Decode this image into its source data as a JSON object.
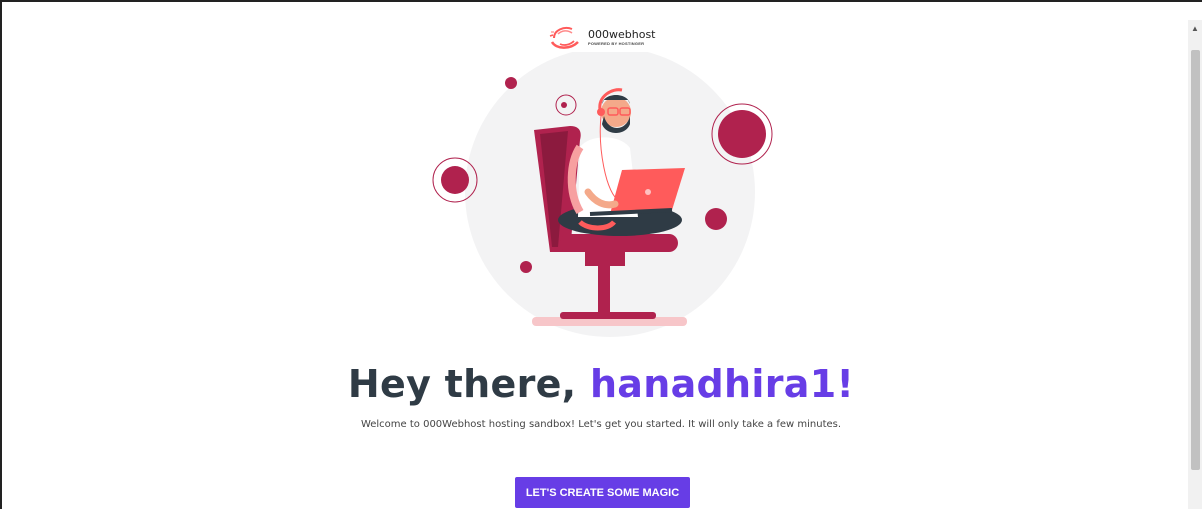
{
  "brand": {
    "name": "000webhost",
    "tagline": "POWERED BY HOSTINGER"
  },
  "greeting": {
    "prefix": "Hey there, ",
    "username": "hanadhira1!"
  },
  "welcome_text": "Welcome to 000Webhost hosting sandbox! Let's get you started. It will only take a few minutes.",
  "cta_label": "LET'S CREATE SOME MAGIC",
  "colors": {
    "accent": "#673de6",
    "heading": "#2f3b45",
    "illustration_red": "#b0224e",
    "logo_red": "#ff5b5b"
  },
  "icons": [
    "logo-swirl-icon",
    "person-with-laptop-illustration",
    "scroll-up-arrow-icon"
  ]
}
